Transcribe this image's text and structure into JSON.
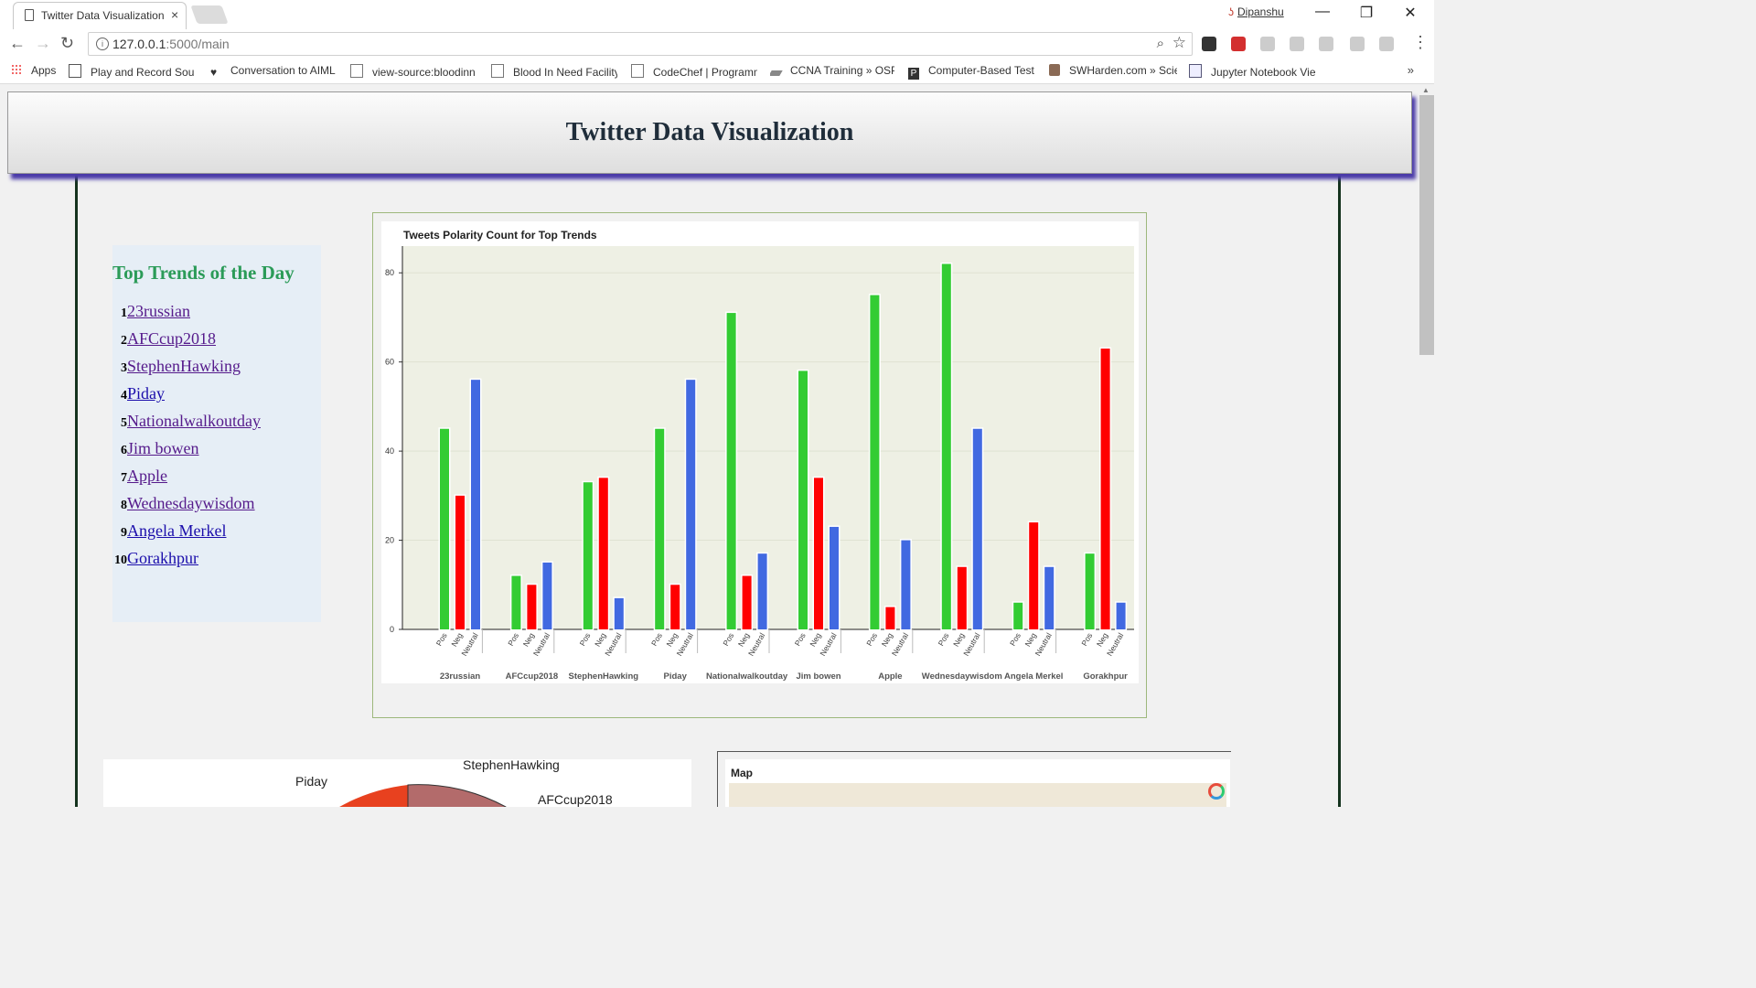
{
  "browser": {
    "tab_title": "Twitter Data Visualization",
    "tab_close": "×",
    "user_name": "Dipanshu",
    "url_host": "127.0.0.1",
    "url_path": ":5000/main",
    "window_controls": [
      "—",
      "❐",
      "✕"
    ],
    "bookmarks": [
      {
        "label": "Apps",
        "icon": "apps-grid-icon"
      },
      {
        "label": "Play and Record Sour",
        "icon": "page-icon"
      },
      {
        "label": "Conversation to AIML",
        "icon": "heart-icon"
      },
      {
        "label": "view-source:bloodinn",
        "icon": "page-icon"
      },
      {
        "label": "Blood In Need Facility",
        "icon": "page-icon"
      },
      {
        "label": "CodeChef | Programm",
        "icon": "page-icon"
      },
      {
        "label": "CCNA Training » OSP",
        "icon": "ccna-icon"
      },
      {
        "label": "Computer-Based Test",
        "icon": "p-icon"
      },
      {
        "label": "SWHarden.com » Scie",
        "icon": "avatar-icon"
      },
      {
        "label": "Jupyter Notebook Vie",
        "icon": "jupyter-icon"
      }
    ],
    "bookmarks_more": "»"
  },
  "page": {
    "title": "Twitter Data Visualization",
    "trends_heading": "Top Trends of the Day",
    "trends": [
      {
        "n": "1",
        "label": "23russian"
      },
      {
        "n": "2",
        "label": "AFCcup2018"
      },
      {
        "n": "3",
        "label": "StephenHawking"
      },
      {
        "n": "4",
        "label": "Piday"
      },
      {
        "n": "5",
        "label": "Nationalwalkoutday"
      },
      {
        "n": "6",
        "label": "Jim bowen"
      },
      {
        "n": "7",
        "label": "Apple"
      },
      {
        "n": "8",
        "label": "Wednesdaywisdom"
      },
      {
        "n": "9",
        "label": "Angela Merkel"
      },
      {
        "n": "10",
        "label": "Gorakhpur"
      }
    ],
    "pie_labels": [
      "StephenHawking",
      "Piday",
      "AFCcup2018"
    ],
    "map_title": "Map"
  },
  "chart_data": {
    "type": "bar",
    "title": "Tweets Polarity Count for Top Trends",
    "categories": [
      "23russian",
      "AFCcup2018",
      "StephenHawking",
      "Piday",
      "Nationalwalkoutday",
      "Jim bowen",
      "Apple",
      "Wednesdaywisdom",
      "Angela Merkel",
      "Gorakhpur"
    ],
    "subcategories": [
      "Pos",
      "Neg",
      "Neutral"
    ],
    "series": [
      {
        "name": "Pos",
        "color": "#33cc33",
        "values": [
          45,
          12,
          33,
          45,
          71,
          58,
          75,
          82,
          6,
          17
        ]
      },
      {
        "name": "Neg",
        "color": "#ff0000",
        "values": [
          30,
          10,
          34,
          10,
          12,
          34,
          5,
          14,
          24,
          63
        ]
      },
      {
        "name": "Neutral",
        "color": "#4169e1",
        "values": [
          56,
          15,
          7,
          56,
          17,
          23,
          20,
          45,
          14,
          6
        ]
      }
    ],
    "yticks": [
      0,
      20,
      40,
      60,
      80
    ],
    "ylim": [
      0,
      86
    ],
    "grid": true,
    "plot_background": "#eef0e4"
  }
}
